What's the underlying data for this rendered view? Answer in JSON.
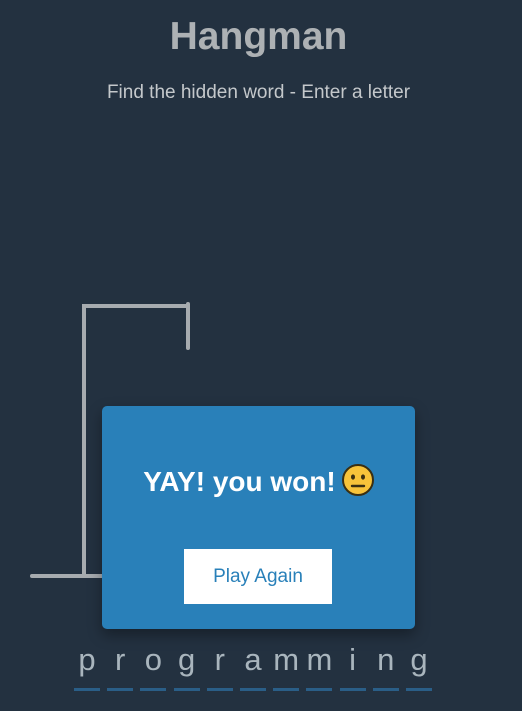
{
  "header": {
    "title": "Hangman",
    "subtitle": "Find the hidden word - Enter a letter"
  },
  "word": {
    "letters": [
      "p",
      "r",
      "o",
      "g",
      "r",
      "a",
      "m",
      "m",
      "i",
      "n",
      "g"
    ]
  },
  "popup": {
    "message": "YAY! you won!",
    "emoji_icon": "neutral-face-icon",
    "play_again_label": "Play Again"
  },
  "colors": {
    "background": "#233140",
    "popup": "#2980b9",
    "figure": "#a6abaf",
    "letter_underline": "#2a5e87"
  }
}
